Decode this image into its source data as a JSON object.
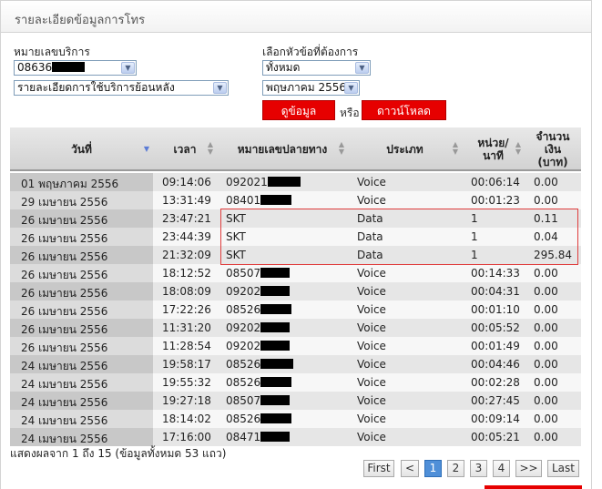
{
  "panel": {
    "title": "รายละเอียดข้อมูลการโทร"
  },
  "form": {
    "service_number_label": "หมายเลขบริการ",
    "service_number_value": "08636",
    "report_type_value": "รายละเอียดการใช้บริการย้อนหลัง",
    "topic_label": "เลือกหัวข้อที่ต้องการ",
    "topic_value": "ทั้งหมด",
    "month_value": "พฤษภาคม 2556",
    "view_button": "ดูข้อมูล",
    "or_label": "หรือ",
    "download_button": "ดาวน์โหลด"
  },
  "table": {
    "headers": {
      "date": "วันที่",
      "time": "เวลา",
      "dest_number": "หมายเลขปลายทาง",
      "type": "ประเภท",
      "unit_line1": "หน่วย/",
      "unit_line2": "นาที",
      "amount_line1": "จำนวน",
      "amount_line2": "เงิน",
      "amount_line3": "(บาท)"
    },
    "rows": [
      {
        "date": "01 พฤษภาคม 2556",
        "time": "09:14:06",
        "number": "092021",
        "type": "Voice",
        "unit": "00:06:14",
        "amount": "0.00"
      },
      {
        "date": "29 เมษายน 2556",
        "time": "13:31:49",
        "number": "08401",
        "type": "Voice",
        "unit": "00:01:23",
        "amount": "0.00"
      },
      {
        "date": "26 เมษายน 2556",
        "time": "23:47:21",
        "number": "SKT",
        "type": "Data",
        "unit": "1",
        "amount": "0.11"
      },
      {
        "date": "26 เมษายน 2556",
        "time": "23:44:39",
        "number": "SKT",
        "type": "Data",
        "unit": "1",
        "amount": "0.04"
      },
      {
        "date": "26 เมษายน 2556",
        "time": "21:32:09",
        "number": "SKT",
        "type": "Data",
        "unit": "1",
        "amount": "295.84"
      },
      {
        "date": "26 เมษายน 2556",
        "time": "18:12:52",
        "number": "08507",
        "type": "Voice",
        "unit": "00:14:33",
        "amount": "0.00"
      },
      {
        "date": "26 เมษายน 2556",
        "time": "18:08:09",
        "number": "09202",
        "type": "Voice",
        "unit": "00:04:31",
        "amount": "0.00"
      },
      {
        "date": "26 เมษายน 2556",
        "time": "17:22:26",
        "number": "08526",
        "type": "Voice",
        "unit": "00:01:10",
        "amount": "0.00"
      },
      {
        "date": "26 เมษายน 2556",
        "time": "11:31:20",
        "number": "09202",
        "type": "Voice",
        "unit": "00:05:52",
        "amount": "0.00"
      },
      {
        "date": "26 เมษายน 2556",
        "time": "11:28:54",
        "number": "09202",
        "type": "Voice",
        "unit": "00:01:49",
        "amount": "0.00"
      },
      {
        "date": "24 เมษายน 2556",
        "time": "19:58:17",
        "number": "08526",
        "type": "Voice",
        "unit": "00:04:46",
        "amount": "0.00"
      },
      {
        "date": "24 เมษายน 2556",
        "time": "19:55:32",
        "number": "08526",
        "type": "Voice",
        "unit": "00:02:28",
        "amount": "0.00"
      },
      {
        "date": "24 เมษายน 2556",
        "time": "19:27:18",
        "number": "08507",
        "type": "Voice",
        "unit": "00:27:45",
        "amount": "0.00"
      },
      {
        "date": "24 เมษายน 2556",
        "time": "18:14:02",
        "number": "08526",
        "type": "Voice",
        "unit": "00:09:14",
        "amount": "0.00"
      },
      {
        "date": "24 เมษายน 2556",
        "time": "17:16:00",
        "number": "08471",
        "type": "Voice",
        "unit": "00:05:21",
        "amount": "0.00"
      }
    ]
  },
  "summary": "แสดงผลจาก 1 ถึง 15 (ข้อมูลทั้งหมด 53 แถว)",
  "pagination": {
    "first": "First",
    "prev": "<",
    "pages": [
      "1",
      "2",
      "3",
      "4"
    ],
    "current": "1",
    "next": ">>",
    "last": "Last"
  },
  "colors": {
    "accent_red": "#e60000",
    "highlight_border": "#e03c3c",
    "active_page": "#4f8fd8"
  },
  "icons": {
    "dropdown": "chevron-down-icon",
    "sort": "sort-arrows-icon"
  }
}
